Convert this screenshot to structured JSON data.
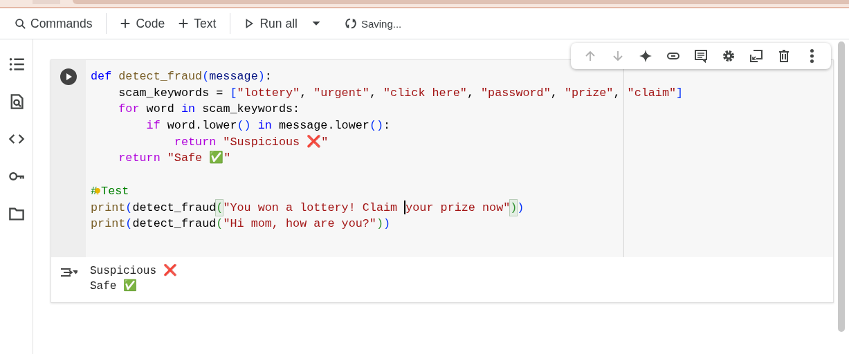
{
  "toolbar": {
    "items": [
      {
        "kind": "search",
        "label": "Commands"
      },
      {
        "kind": "divider"
      },
      {
        "kind": "add",
        "label": "Code"
      },
      {
        "kind": "add",
        "label": "Text"
      },
      {
        "kind": "divider"
      },
      {
        "kind": "run",
        "label": "Run all"
      },
      {
        "kind": "dropdown"
      },
      {
        "kind": "status",
        "label": "Saving..."
      }
    ]
  },
  "sidebar": {
    "items": [
      {
        "kind": "toc"
      },
      {
        "kind": "find"
      },
      {
        "kind": "code"
      },
      {
        "kind": "key"
      },
      {
        "kind": "folder"
      }
    ]
  },
  "cell_toolbar": {
    "items": [
      {
        "kind": "up",
        "disabled": true
      },
      {
        "kind": "down",
        "disabled": true
      },
      {
        "kind": "sparkle",
        "disabled": false
      },
      {
        "kind": "link",
        "disabled": false
      },
      {
        "kind": "comment",
        "disabled": false
      },
      {
        "kind": "gear",
        "disabled": false
      },
      {
        "kind": "mirror",
        "disabled": false
      },
      {
        "kind": "trash",
        "disabled": false
      },
      {
        "kind": "more",
        "disabled": false
      }
    ]
  },
  "code_cell": {
    "lines": [
      {
        "kind": "code",
        "tokens": [
          {
            "text": "def",
            "kind": "kw"
          },
          {
            "text": " detect_fraud",
            "kind": "fn"
          },
          {
            "text": "(",
            "kind": "br"
          },
          {
            "text": "message",
            "kind": "var"
          },
          {
            "text": ")",
            "kind": "br"
          },
          {
            "text": ":",
            "kind": "plain"
          }
        ]
      },
      {
        "kind": "code",
        "tokens": [
          {
            "text": "    scam_keywords = ",
            "kind": "plain"
          },
          {
            "text": "[",
            "kind": "br"
          },
          {
            "text": "\"lottery\"",
            "kind": "str"
          },
          {
            "text": ", ",
            "kind": "plain"
          },
          {
            "text": "\"urgent\"",
            "kind": "str"
          },
          {
            "text": ", ",
            "kind": "plain"
          },
          {
            "text": "\"click here\"",
            "kind": "str"
          },
          {
            "text": ", ",
            "kind": "plain"
          },
          {
            "text": "\"password\"",
            "kind": "str"
          },
          {
            "text": ", ",
            "kind": "plain"
          },
          {
            "text": "\"prize\"",
            "kind": "str"
          },
          {
            "text": ", ",
            "kind": "plain"
          },
          {
            "text": "\"claim\"",
            "kind": "str"
          },
          {
            "text": "]",
            "kind": "br"
          }
        ]
      },
      {
        "kind": "code",
        "tokens": [
          {
            "text": "    for",
            "kind": "ctl"
          },
          {
            "text": " word ",
            "kind": "plain"
          },
          {
            "text": "in",
            "kind": "kw"
          },
          {
            "text": " scam_keywords:",
            "kind": "plain"
          }
        ]
      },
      {
        "kind": "code",
        "tokens": [
          {
            "text": "        if",
            "kind": "ctl"
          },
          {
            "text": " word.lower",
            "kind": "plain"
          },
          {
            "text": "()",
            "kind": "br"
          },
          {
            "text": " in",
            "kind": "kw"
          },
          {
            "text": " message.lower",
            "kind": "plain"
          },
          {
            "text": "()",
            "kind": "br"
          },
          {
            "text": ":",
            "kind": "plain"
          }
        ]
      },
      {
        "kind": "code",
        "tokens": [
          {
            "text": "            return",
            "kind": "ctl"
          },
          {
            "text": " \"Suspicious ❌\"",
            "kind": "str"
          }
        ]
      },
      {
        "kind": "code",
        "tokens": [
          {
            "text": "    return",
            "kind": "ctl"
          },
          {
            "text": " \"Safe ✅\"",
            "kind": "str"
          }
        ]
      },
      {
        "kind": "blank"
      },
      {
        "kind": "code",
        "tokens": [
          {
            "text": "#",
            "kind": "com"
          },
          {
            "kind": "bulb"
          },
          {
            "text": "Test",
            "kind": "com"
          }
        ]
      },
      {
        "kind": "code",
        "tokens": [
          {
            "text": "print",
            "kind": "fn"
          },
          {
            "text": "(",
            "kind": "br"
          },
          {
            "text": "detect_fraud",
            "kind": "plain"
          },
          {
            "text": "(",
            "kind": "br2hl"
          },
          {
            "text": "\"You won a lottery! Claim ",
            "kind": "str"
          },
          {
            "kind": "cursor"
          },
          {
            "text": "your prize now\"",
            "kind": "str"
          },
          {
            "text": ")",
            "kind": "br2hl"
          },
          {
            "text": ")",
            "kind": "br"
          }
        ]
      },
      {
        "kind": "code",
        "tokens": [
          {
            "text": "print",
            "kind": "fn"
          },
          {
            "text": "(",
            "kind": "br"
          },
          {
            "text": "detect_fraud",
            "kind": "plain"
          },
          {
            "text": "(",
            "kind": "br2"
          },
          {
            "text": "\"Hi mom, how are you?\"",
            "kind": "str"
          },
          {
            "text": ")",
            "kind": "br2"
          },
          {
            "text": ")",
            "kind": "br"
          }
        ]
      }
    ],
    "output": [
      "Suspicious ❌",
      "Safe ✅"
    ]
  }
}
